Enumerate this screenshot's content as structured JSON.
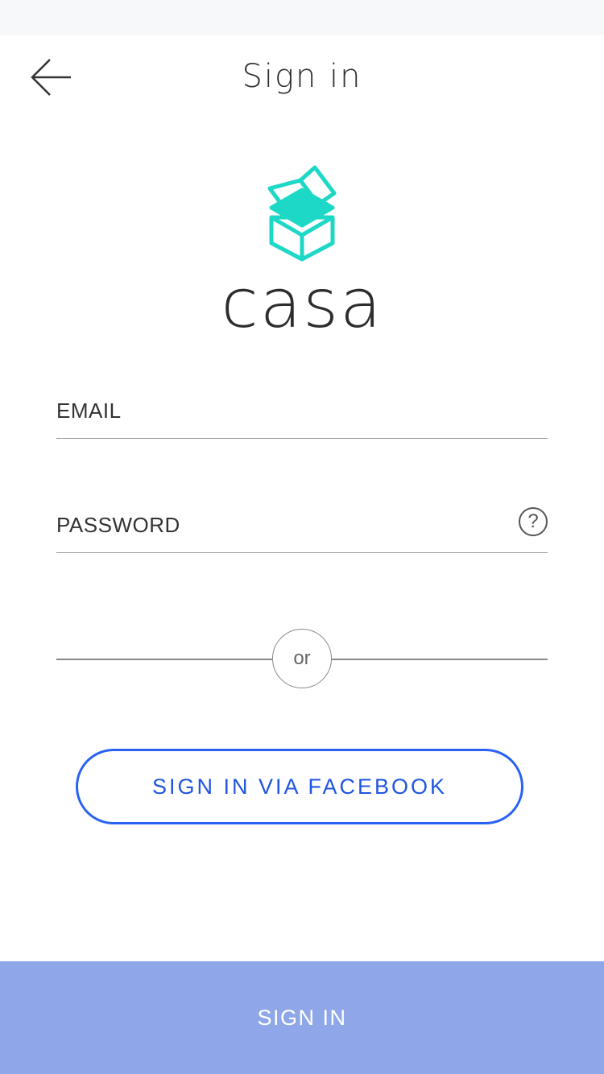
{
  "header": {
    "title": "Sign in",
    "back_icon": "arrow-left-icon"
  },
  "brand": {
    "name": "casa",
    "logo_icon": "open-box-icon",
    "logo_color": "#1dd8c6"
  },
  "form": {
    "email_placeholder": "EMAIL",
    "email_value": "",
    "password_placeholder": "PASSWORD",
    "password_value": "",
    "help_icon_text": "?",
    "help_icon": "question-circle-icon"
  },
  "divider": {
    "label": "or"
  },
  "facebook": {
    "label": "SIGN IN VIA FACEBOOK",
    "color": "#2962f2"
  },
  "signin": {
    "label": "SIGN IN",
    "color": "#8fa7e8"
  }
}
